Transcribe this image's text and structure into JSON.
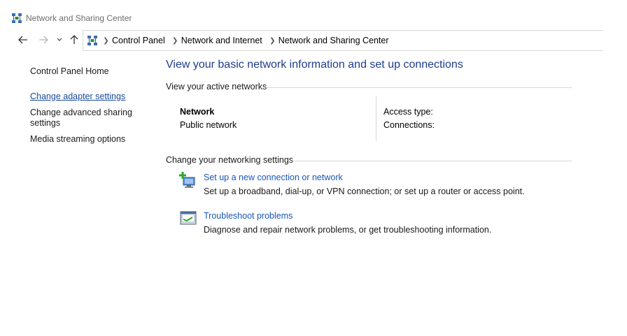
{
  "window": {
    "title": "Network and Sharing Center",
    "icon": "network-sharing-icon"
  },
  "nav": {
    "back_icon": "arrow-left-icon",
    "forward_icon": "arrow-right-icon",
    "recent_icon": "chevron-down-icon",
    "up_icon": "arrow-up-icon"
  },
  "address": {
    "crumbs": [
      "Control Panel",
      "Network and Internet",
      "Network and Sharing Center"
    ]
  },
  "sidebar": {
    "items": [
      {
        "label": "Control Panel Home"
      },
      {
        "label": "Change adapter settings"
      },
      {
        "label": "Change advanced sharing\nsettings",
        "line1": "Change advanced sharing",
        "line2": "settings"
      },
      {
        "label": "Media streaming options"
      }
    ]
  },
  "main": {
    "heading": "View your basic network information and set up connections",
    "active_networks": {
      "section_title": "View your active networks",
      "network_name": "Network",
      "network_category": "Public network",
      "access_type_label": "Access type:",
      "connections_label": "Connections:"
    },
    "networking_settings": {
      "section_title": "Change your networking settings",
      "tasks": [
        {
          "icon": "new-connection-icon",
          "link": "Set up a new connection or network",
          "description": "Set up a broadband, dial-up, or VPN connection; or set up a router or access point."
        },
        {
          "icon": "troubleshoot-icon",
          "link": "Troubleshoot problems",
          "description": "Diagnose and repair network problems, or get troubleshooting information."
        }
      ]
    }
  },
  "colors": {
    "heading": "#1e3c8c",
    "link": "#1a56b8",
    "rule": "#d6d6d6"
  }
}
